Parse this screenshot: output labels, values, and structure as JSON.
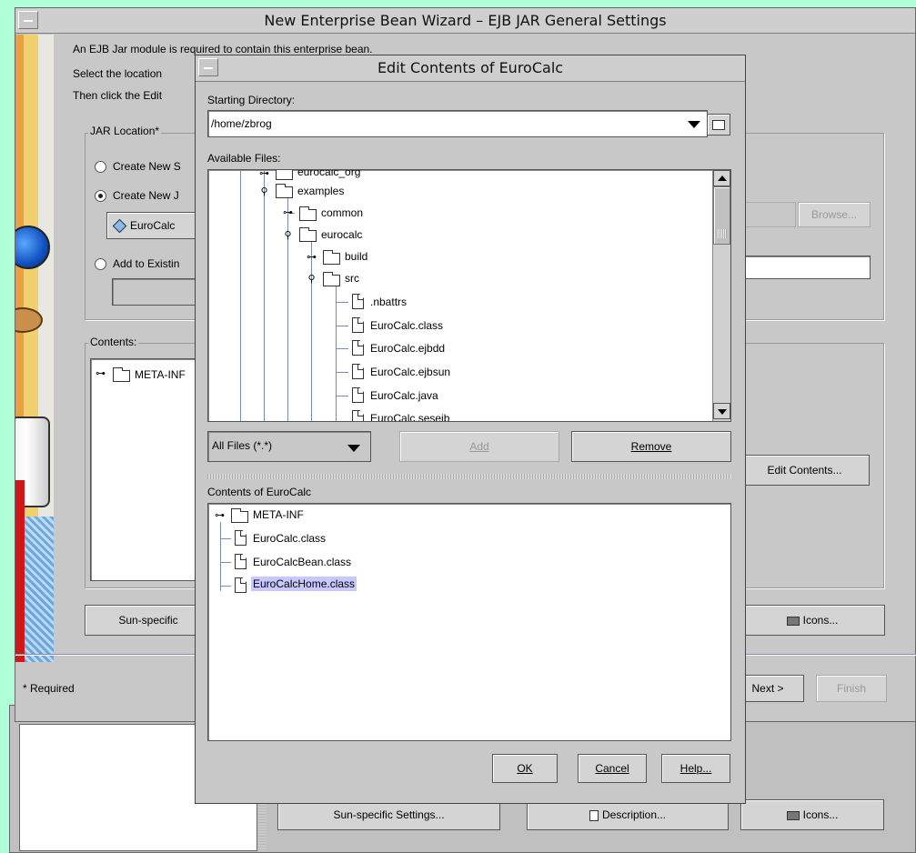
{
  "wizard": {
    "title": "New Enterprise Bean Wizard – EJB JAR General Settings",
    "intro_line1": "An EJB Jar module is required to contain this enterprise bean.",
    "intro_line2": "Select the location",
    "intro_line3": "Then click the Edit",
    "jar_location_legend": "JAR Location*",
    "radio_create_new_s": "Create New S",
    "radio_create_new_j": "Create New J",
    "eurocalc_chip": "EuroCalc",
    "radio_add_existing": "Add to Existin",
    "browse_button": "Browse...",
    "contents_legend": "Contents:",
    "contents_tree_item": "META-INF",
    "edit_contents_button": "Edit Contents...",
    "sun_specific_button": "Sun-specific",
    "icons_button": "Icons...",
    "required_note": "* Required",
    "next_button": "Next >",
    "finish_button": "Finish"
  },
  "background_bar": {
    "sun_specific": "Sun-specific Settings...",
    "description": "Description...",
    "icons": "Icons..."
  },
  "dialog": {
    "title": "Edit Contents of EuroCalc",
    "starting_dir_label": "Starting Directory:",
    "starting_dir_value": "/home/zbrog",
    "available_files_label": "Available Files:",
    "tree": [
      {
        "name": "eurocalc_org",
        "type": "folder"
      },
      {
        "name": "examples",
        "type": "folder"
      },
      {
        "name": "common",
        "type": "folder"
      },
      {
        "name": "eurocalc",
        "type": "folder"
      },
      {
        "name": "build",
        "type": "folder"
      },
      {
        "name": "src",
        "type": "folder"
      },
      {
        "name": ".nbattrs",
        "type": "file"
      },
      {
        "name": "EuroCalc.class",
        "type": "file"
      },
      {
        "name": "EuroCalc.ejbdd",
        "type": "file"
      },
      {
        "name": "EuroCalc.ejbsun",
        "type": "file"
      },
      {
        "name": "EuroCalc.java",
        "type": "file"
      },
      {
        "name": "EuroCalc.seseib",
        "type": "file"
      }
    ],
    "filter_value": "All Files (*.*)",
    "add_button": "Add",
    "remove_button": "Remove",
    "contents_label": "Contents of EuroCalc",
    "contents_tree": [
      {
        "name": "META-INF",
        "type": "folder"
      },
      {
        "name": "EuroCalc.class",
        "type": "file"
      },
      {
        "name": "EuroCalcBean.class",
        "type": "file"
      },
      {
        "name": "EuroCalcHome.class",
        "type": "file",
        "selected": true
      }
    ],
    "ok_button": "OK",
    "cancel_button": "Cancel",
    "help_button": "Help..."
  },
  "colors": {
    "desktop": "#afffd8",
    "window": "#c8c8c8",
    "selection": "#c8c8ff"
  }
}
